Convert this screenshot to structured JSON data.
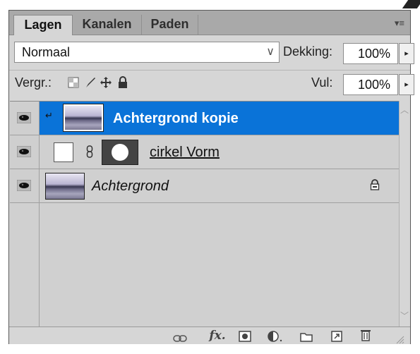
{
  "tabs": [
    {
      "label": "Lagen",
      "active": true
    },
    {
      "label": "Kanalen",
      "active": false
    },
    {
      "label": "Paden",
      "active": false
    }
  ],
  "blend_mode": {
    "value": "Normaal"
  },
  "opacity": {
    "label": "Dekking:",
    "value": "100%"
  },
  "lock": {
    "label": "Vergr.:"
  },
  "fill": {
    "label": "Vul:",
    "value": "100%"
  },
  "layers": [
    {
      "name": "Achtergrond kopie",
      "selected": true,
      "visible": true
    },
    {
      "name": "cirkel Vorm",
      "selected": false,
      "visible": true,
      "has_mask": true
    },
    {
      "name": "Achtergrond",
      "selected": false,
      "visible": true,
      "locked": true
    }
  ],
  "toolbar_icons": [
    "link-layers-icon",
    "fx-icon",
    "layer-mask-icon",
    "adjustment-layer-icon",
    "new-group-icon",
    "new-layer-icon",
    "delete-layer-icon"
  ],
  "fx_label": "fx",
  "colors": {
    "selection": "#0a73d8",
    "panel": "#d6d6d6",
    "tabbar": "#a9a9a9"
  }
}
